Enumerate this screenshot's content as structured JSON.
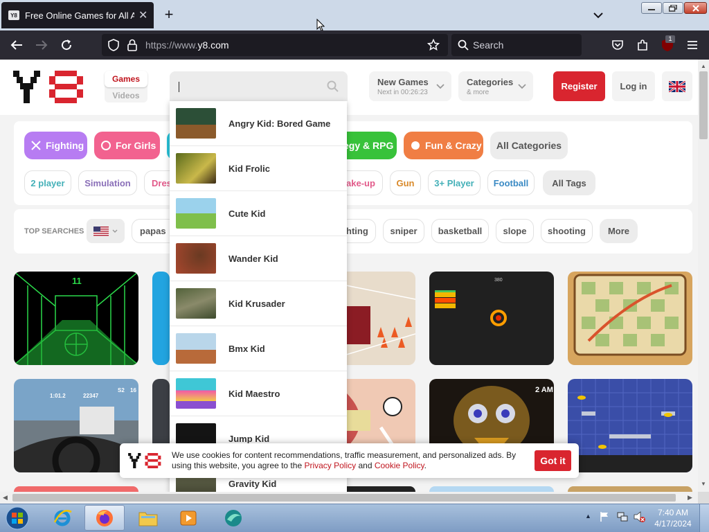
{
  "browser": {
    "tab_title": "Free Online Games for All Ages",
    "tab_favicon": "Y8",
    "new_tab": "+",
    "url_scheme": "https://www.",
    "url_domain": "y8.com",
    "search_placeholder": "Search",
    "extension_badge": "1"
  },
  "header": {
    "nav_games": "Games",
    "nav_videos": "Videos",
    "new_games_title": "New Games",
    "new_games_sub": "Next in 00:26:23",
    "categories_title": "Categories",
    "categories_sub": "& more",
    "register": "Register",
    "login": "Log in"
  },
  "categories": {
    "row1": [
      "Fighting",
      "For Girls",
      "egy & RPG",
      "Fun & Crazy",
      "All Categories"
    ],
    "row2": [
      "2 player",
      "Simulation",
      "Dres",
      "ake-up",
      "Gun",
      "3+ Player",
      "Football",
      "All Tags"
    ]
  },
  "top_searches": {
    "label": "TOP SEARCHES",
    "items": [
      "papas",
      "hting",
      "sniper",
      "basketball",
      "slope",
      "shooting",
      "More"
    ]
  },
  "dropdown": {
    "items": [
      "Angry Kid: Bored Game",
      "Kid Frolic",
      "Cute Kid",
      "Wander Kid",
      "Kid Krusader",
      "Bmx Kid",
      "Kid Maestro",
      "Jump Kid",
      "Gravity Kid"
    ]
  },
  "thumbs": {
    "race_number": "11",
    "car_hud_time": "1:01.2",
    "car_hud_score": "22347",
    "car_hud_pos": "S2",
    "car_hud_speed": "16",
    "fnaf_time": "2 AM",
    "orbit_score": "380"
  },
  "cookie": {
    "text1": "We use cookies for content recommendations, traffic measurement, and personalized ads. By using this website, you agree to the ",
    "privacy": "Privacy Policy",
    "and": " and ",
    "cookie_policy": "Cookie Policy",
    "period": ".",
    "got_it": "Got it"
  },
  "taskbar": {
    "time": "7:40 AM",
    "date": "4/17/2024"
  },
  "colors": {
    "brand_red": "#d9252f",
    "fighting": "#b77cf2",
    "for_girls": "#f2628f",
    "rpg": "#38c23a",
    "fun_crazy": "#f07e44"
  }
}
